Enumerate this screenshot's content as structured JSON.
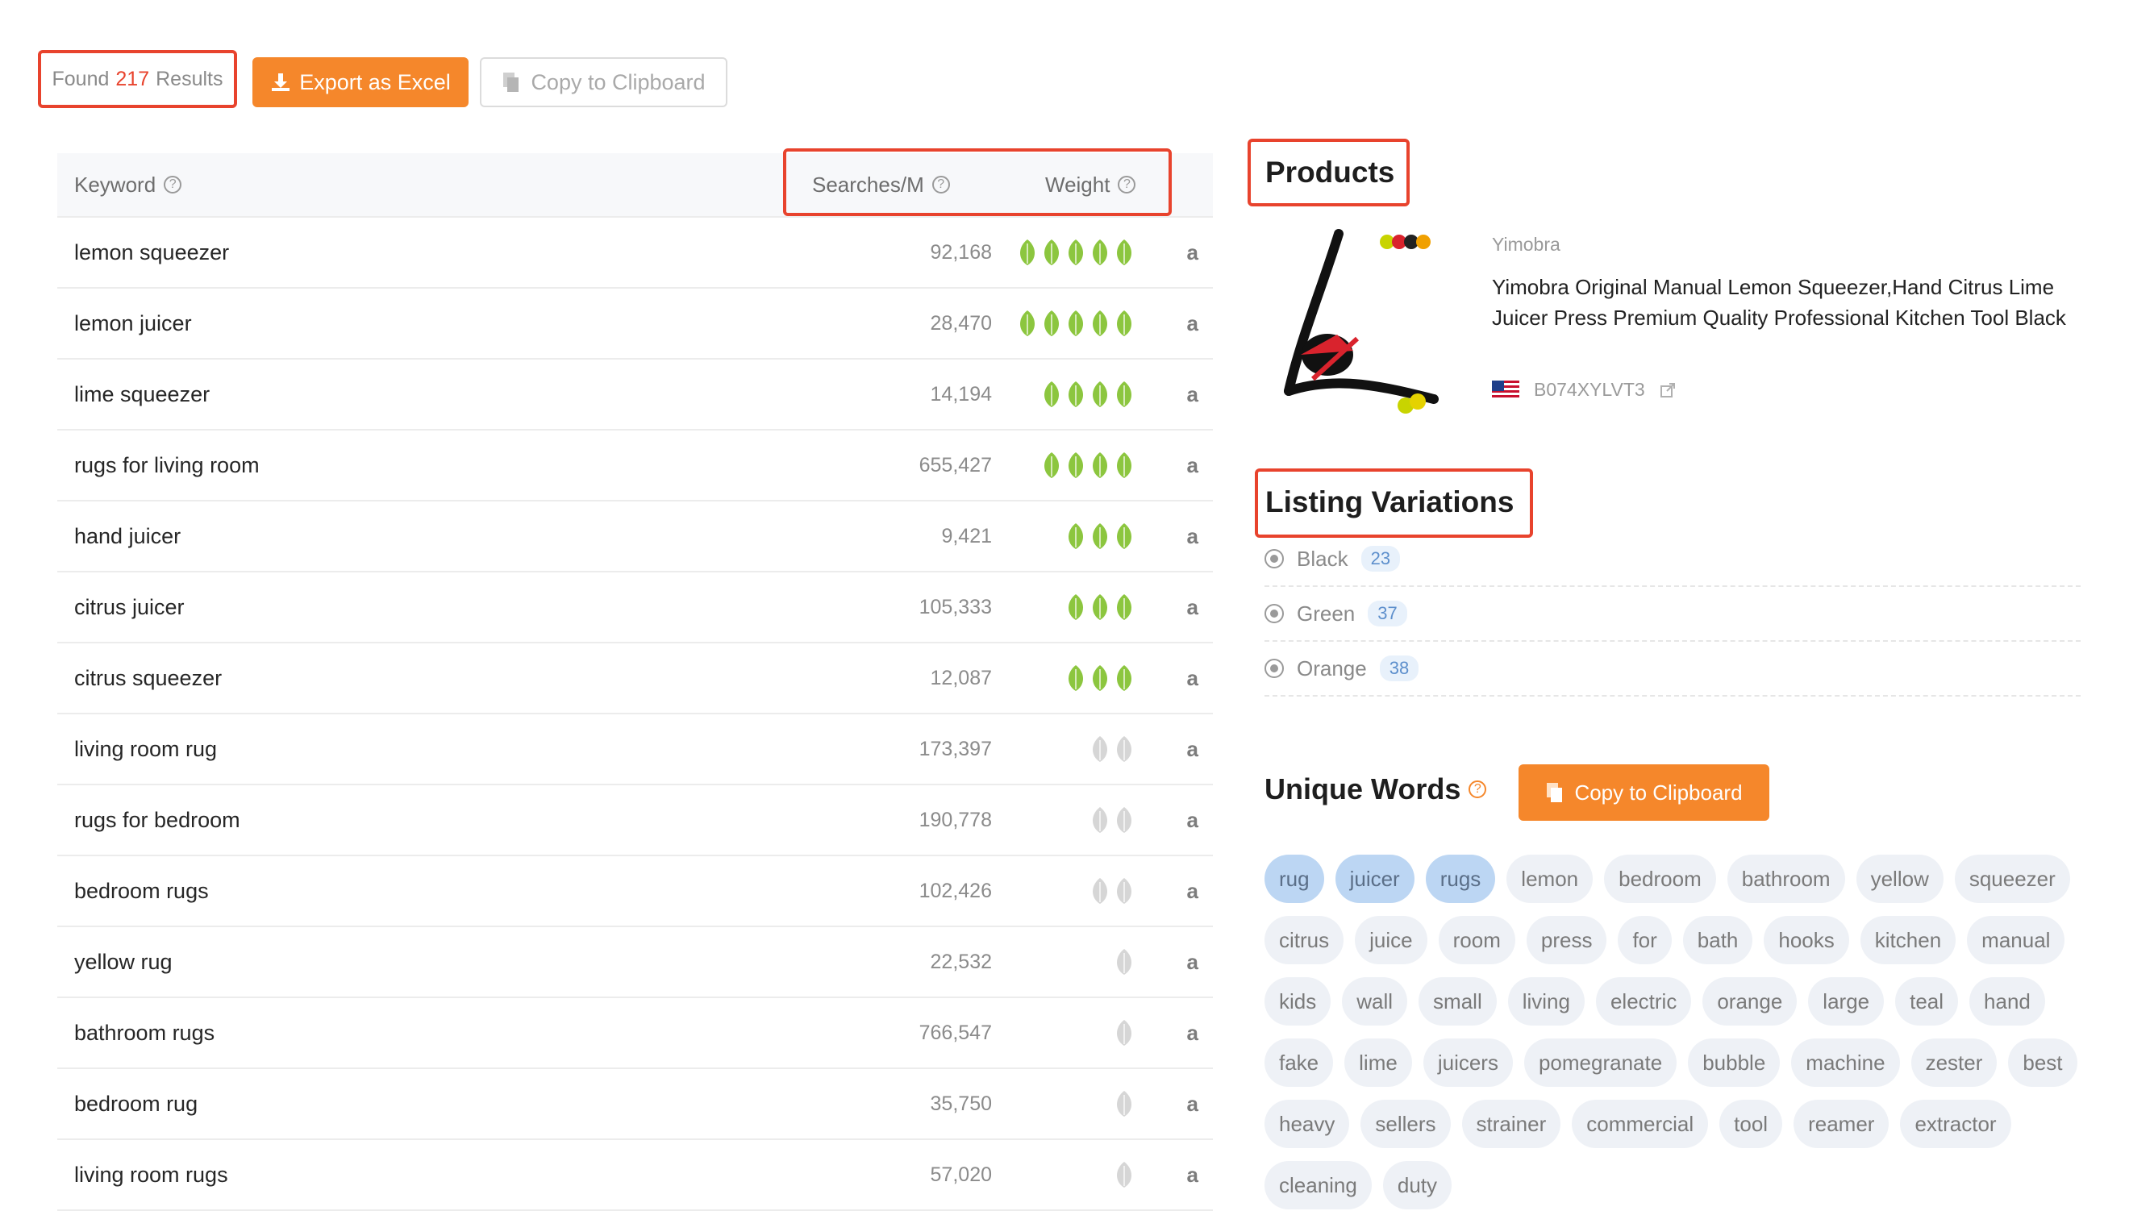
{
  "toolbar": {
    "found_prefix": "Found",
    "found_count": "217",
    "found_suffix": "Results",
    "export_label": "Export as Excel",
    "copy_label": "Copy to Clipboard"
  },
  "table": {
    "headers": {
      "keyword": "Keyword",
      "searches": "Searches/M",
      "weight": "Weight"
    },
    "rows": [
      {
        "keyword": "lemon squeezer",
        "searches": "92,168",
        "weight": 5,
        "level": "green"
      },
      {
        "keyword": "lemon juicer",
        "searches": "28,470",
        "weight": 5,
        "level": "green"
      },
      {
        "keyword": "lime squeezer",
        "searches": "14,194",
        "weight": 4,
        "level": "green"
      },
      {
        "keyword": "rugs for living room",
        "searches": "655,427",
        "weight": 4,
        "level": "green"
      },
      {
        "keyword": "hand juicer",
        "searches": "9,421",
        "weight": 3,
        "level": "green"
      },
      {
        "keyword": "citrus juicer",
        "searches": "105,333",
        "weight": 3,
        "level": "green"
      },
      {
        "keyword": "citrus squeezer",
        "searches": "12,087",
        "weight": 3,
        "level": "green"
      },
      {
        "keyword": "living room rug",
        "searches": "173,397",
        "weight": 2,
        "level": "gray"
      },
      {
        "keyword": "rugs for bedroom",
        "searches": "190,778",
        "weight": 2,
        "level": "gray"
      },
      {
        "keyword": "bedroom rugs",
        "searches": "102,426",
        "weight": 2,
        "level": "gray"
      },
      {
        "keyword": "yellow rug",
        "searches": "22,532",
        "weight": 1,
        "level": "gray"
      },
      {
        "keyword": "bathroom rugs",
        "searches": "766,547",
        "weight": 1,
        "level": "gray"
      },
      {
        "keyword": "bedroom rug",
        "searches": "35,750",
        "weight": 1,
        "level": "gray"
      },
      {
        "keyword": "living room rugs",
        "searches": "57,020",
        "weight": 1,
        "level": "gray"
      }
    ],
    "amazon_icon": "amazon-icon"
  },
  "products": {
    "title": "Products",
    "brand": "Yimobra",
    "name": "Yimobra Original Manual Lemon Squeezer,Hand Citrus Lime Juicer Press Premium Quality Professional Kitchen Tool Black",
    "asin": "B074XYLVT3",
    "flag": "us-flag-icon"
  },
  "variations": {
    "title": "Listing Variations",
    "items": [
      {
        "name": "Black",
        "count": "23"
      },
      {
        "name": "Green",
        "count": "37"
      },
      {
        "name": "Orange",
        "count": "38"
      }
    ]
  },
  "unique_words": {
    "title": "Unique Words",
    "copy_label": "Copy to Clipboard",
    "words": [
      {
        "text": "rug",
        "selected": true
      },
      {
        "text": "juicer",
        "selected": true
      },
      {
        "text": "rugs",
        "selected": true
      },
      {
        "text": "lemon",
        "selected": false
      },
      {
        "text": "bedroom",
        "selected": false
      },
      {
        "text": "bathroom",
        "selected": false
      },
      {
        "text": "yellow",
        "selected": false
      },
      {
        "text": "squeezer",
        "selected": false
      },
      {
        "text": "citrus",
        "selected": false
      },
      {
        "text": "juice",
        "selected": false
      },
      {
        "text": "room",
        "selected": false
      },
      {
        "text": "press",
        "selected": false
      },
      {
        "text": "for",
        "selected": false
      },
      {
        "text": "bath",
        "selected": false
      },
      {
        "text": "hooks",
        "selected": false
      },
      {
        "text": "kitchen",
        "selected": false
      },
      {
        "text": "manual",
        "selected": false
      },
      {
        "text": "kids",
        "selected": false
      },
      {
        "text": "wall",
        "selected": false
      },
      {
        "text": "small",
        "selected": false
      },
      {
        "text": "living",
        "selected": false
      },
      {
        "text": "electric",
        "selected": false
      },
      {
        "text": "orange",
        "selected": false
      },
      {
        "text": "large",
        "selected": false
      },
      {
        "text": "teal",
        "selected": false
      },
      {
        "text": "hand",
        "selected": false
      },
      {
        "text": "fake",
        "selected": false
      },
      {
        "text": "lime",
        "selected": false
      },
      {
        "text": "juicers",
        "selected": false
      },
      {
        "text": "pomegranate",
        "selected": false
      },
      {
        "text": "bubble",
        "selected": false
      },
      {
        "text": "machine",
        "selected": false
      },
      {
        "text": "zester",
        "selected": false
      },
      {
        "text": "best",
        "selected": false
      },
      {
        "text": "heavy",
        "selected": false
      },
      {
        "text": "sellers",
        "selected": false
      },
      {
        "text": "strainer",
        "selected": false
      },
      {
        "text": "commercial",
        "selected": false
      },
      {
        "text": "tool",
        "selected": false
      },
      {
        "text": "reamer",
        "selected": false
      },
      {
        "text": "extractor",
        "selected": false
      },
      {
        "text": "cleaning",
        "selected": false
      },
      {
        "text": "duty",
        "selected": false
      }
    ]
  },
  "colors": {
    "accent_orange": "#f5872b",
    "highlight_red": "#e8432d",
    "leaf_green": "#8cc63f",
    "leaf_gray": "#d6d6d6",
    "chip_selected": "#bcd6f3"
  }
}
